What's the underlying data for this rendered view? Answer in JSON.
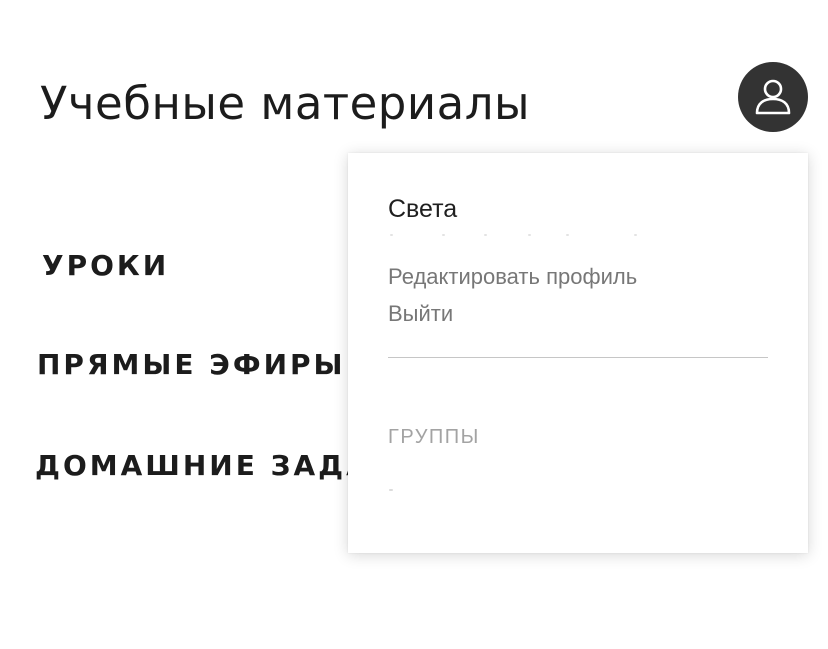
{
  "header": {
    "title": "Учебные материалы",
    "avatar_icon": "user-icon",
    "avatar_color": "#333333"
  },
  "nav": {
    "items": [
      {
        "label": "УРОКИ"
      },
      {
        "label": "ПРЯМЫЕ ЭФИРЫ"
      },
      {
        "label": "ДОМАШНИЕ ЗАДА"
      }
    ]
  },
  "profile_menu": {
    "username": "Света",
    "edit_profile_label": "Редактировать профиль",
    "logout_label": "Выйти",
    "groups_heading": "ГРУППЫ"
  },
  "colors": {
    "text_primary": "#1c1c1c",
    "text_secondary": "#777777",
    "text_muted": "#a3a3a3",
    "divider": "#c6c6c6"
  }
}
